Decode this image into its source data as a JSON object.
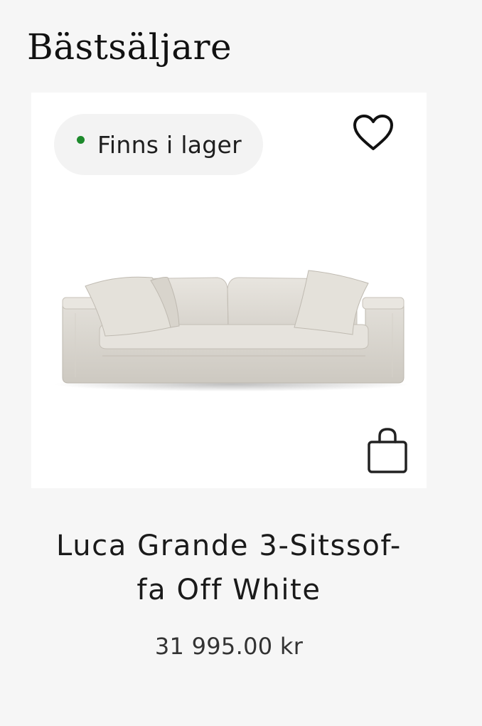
{
  "section": {
    "title": "Bästsäljare"
  },
  "product": {
    "stock_status": "Finns i lager",
    "stock_color": "#1d8a2c",
    "wishlist_icon": "heart-icon",
    "cart_icon": "shopping-bag-icon",
    "name_line1": "Luca Grande 3-Sitssof-",
    "name_line2": "fa Off White",
    "price": "31 995.00 kr"
  }
}
